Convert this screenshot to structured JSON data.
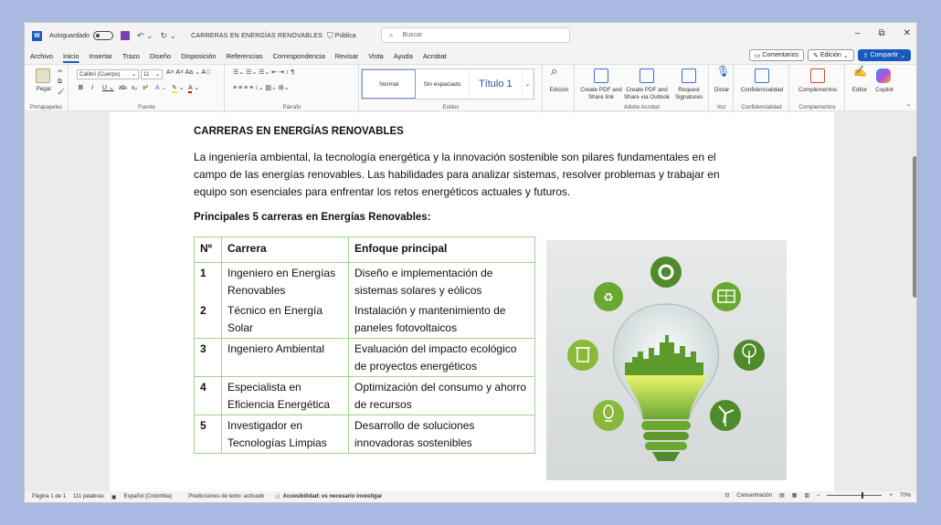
{
  "titlebar": {
    "app_icon": "W",
    "autosave_label": "Autoguardado",
    "doc_title": "CARRERAS EN ENERGÍAS RENOVABLES",
    "visibility": "Pública",
    "search_placeholder": "Buscar",
    "minimize": "–",
    "restore": "⧉",
    "close": "✕"
  },
  "menu": {
    "items": [
      "Archivo",
      "Inicio",
      "Insertar",
      "Trazo",
      "Diseño",
      "Disposición",
      "Referencias",
      "Correspondencia",
      "Revisar",
      "Vista",
      "Ayuda",
      "Acrobat"
    ],
    "active": "Inicio",
    "comments": "Comentarios",
    "editing": "Edición",
    "share": "Compartir"
  },
  "ribbon": {
    "paste": "Pegar",
    "font_name": "Calibri (Cuerpo)",
    "font_size": "11",
    "styles": [
      "Normal",
      "Sin espaciado",
      "Título 1"
    ],
    "edition": "Edición",
    "create_pdf": "Create PDF and Share link",
    "create_pdf_outlook": "Create PDF and Share via Outlook",
    "request_signatures": "Request Signatures",
    "dictate": "Dictar",
    "confidentiality": "Confidencialidad",
    "addins": "Complementos",
    "editor": "Editor",
    "copilot": "Copilot",
    "group_labels": {
      "clipboard": "Portapapeles",
      "font": "Fuente",
      "paragraph": "Párrafo",
      "styles": "Estilos",
      "acrobat": "Adobe Acrobat",
      "voice": "Voz",
      "confidentiality": "Confidencialidad",
      "addins": "Complementos"
    }
  },
  "document": {
    "heading": "CARRERAS EN ENERGÍAS RENOVABLES",
    "intro": "La ingeniería ambiental, la tecnología energética y la innovación sostenible son pilares fundamentales en el campo de las energías renovables. Las habilidades para analizar sistemas, resolver problemas y trabajar en equipo son esenciales para enfrentar los retos energéticos actuales y futuros.",
    "subheading": "Principales 5 carreras en Energías Renovables:",
    "table": {
      "headers": [
        "Nº",
        "Carrera",
        "Enfoque principal"
      ],
      "rows": [
        {
          "num": "1",
          "career": "Ingeniero en Energías Renovables",
          "focus": "Diseño e implementación de sistemas solares y eólicos"
        },
        {
          "num": "2",
          "career": "Técnico en Energía Solar",
          "focus": "Instalación y mantenimiento de paneles fotovoltaicos"
        },
        {
          "num": "3",
          "career": "Ingeniero Ambiental",
          "focus": "Evaluación del impacto ecológico de proyectos energéticos"
        },
        {
          "num": "4",
          "career": "Especialista en Eficiencia Energética",
          "focus": "Optimización del consumo y ahorro de recursos"
        },
        {
          "num": "5",
          "career": "Investigador en Tecnologías Limpias",
          "focus": "Desarrollo de soluciones innovadoras sostenibles"
        }
      ]
    }
  },
  "status": {
    "page": "Página 1 de 1",
    "words": "111 palabras",
    "language": "Español (Colombia)",
    "predictions": "Predicciones de texto: activado",
    "accessibility": "Accesibilidad: es necesario investigar",
    "focus": "Concentración",
    "zoom": "70%"
  },
  "colors": {
    "accent": "#185abd",
    "table_border": "#9fd28f",
    "bulb_green": "#6aa832",
    "icon_green": "#4f8a2b"
  }
}
